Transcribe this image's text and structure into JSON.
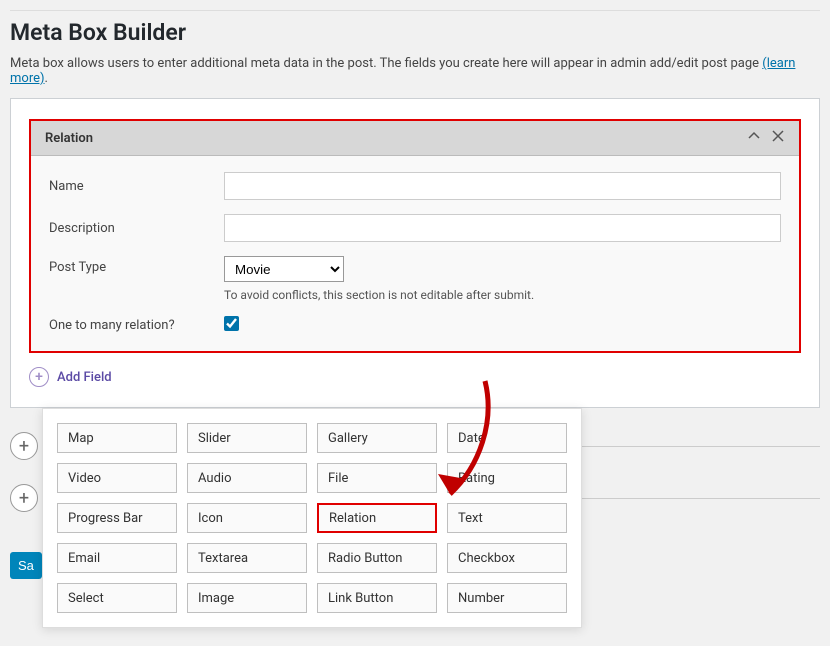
{
  "header": {
    "title": "Meta Box Builder",
    "intro_text": "Meta box allows users to enter additional meta data in the post. The fields you create here will appear in admin add/edit post page",
    "learn_more": "(learn more)"
  },
  "section": {
    "title": "Relation",
    "fields": {
      "name_label": "Name",
      "name_value": "",
      "description_label": "Description",
      "description_value": "",
      "post_type_label": "Post Type",
      "post_type_value": "Movie",
      "post_type_hint": "To avoid conflicts, this section is not editable after submit.",
      "one_to_many_label": "One to many relation?",
      "one_to_many_checked": true
    }
  },
  "add_field_label": "Add Field",
  "field_types": [
    "Map",
    "Slider",
    "Gallery",
    "Date",
    "Video",
    "Audio",
    "File",
    "Rating",
    "Progress Bar",
    "Icon",
    "Relation",
    "Text",
    "Email",
    "Textarea",
    "Radio Button",
    "Checkbox",
    "Select",
    "Image",
    "Link Button",
    "Number"
  ],
  "highlighted_field": "Relation",
  "save_label": "Sa"
}
